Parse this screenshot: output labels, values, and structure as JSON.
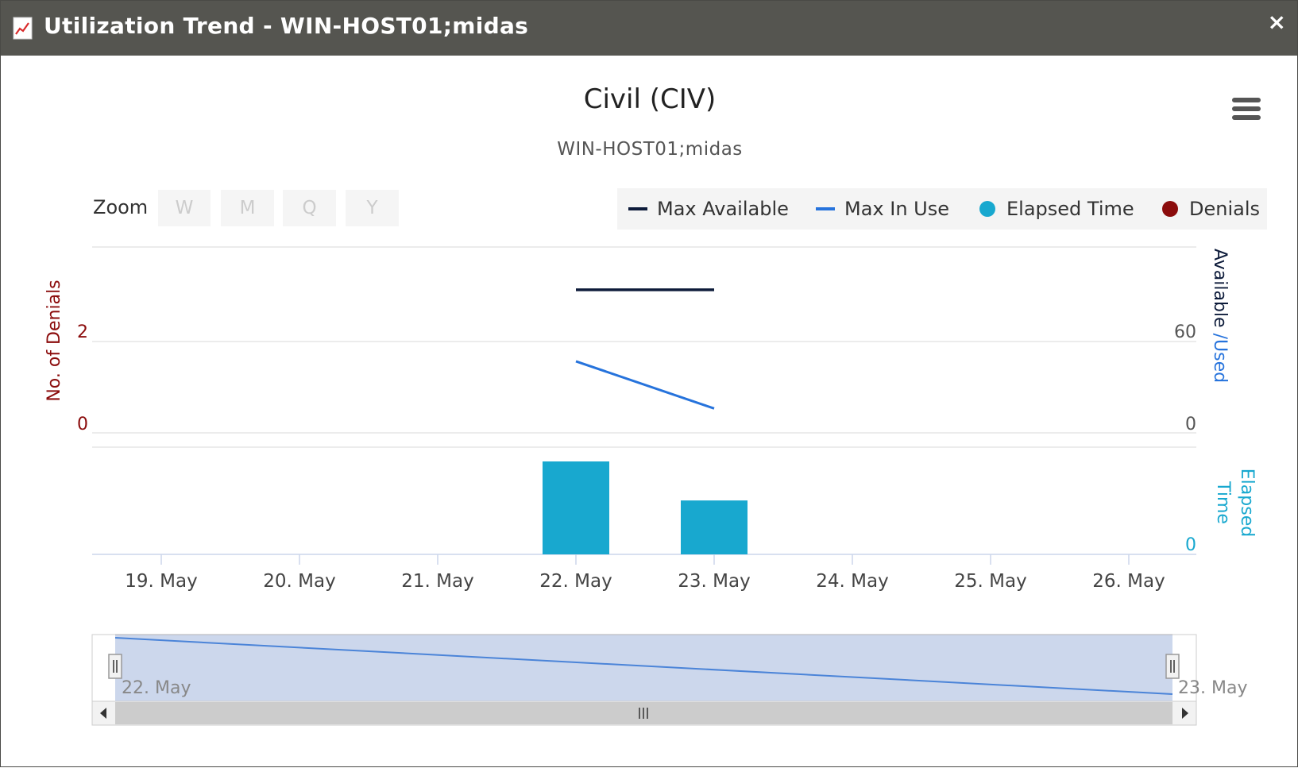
{
  "window": {
    "title": "Utilization Trend - WIN-HOST01;midas",
    "close_label": "×"
  },
  "chart": {
    "title": "Civil (CIV)",
    "subtitle": "WIN-HOST01;midas"
  },
  "zoom": {
    "label": "Zoom",
    "buttons": [
      "W",
      "M",
      "Q",
      "Y"
    ]
  },
  "legend": {
    "items": [
      {
        "label": "Max Available",
        "color": "#0d1b3a",
        "symbol": "line"
      },
      {
        "label": "Max In Use",
        "color": "#2673dc",
        "symbol": "line"
      },
      {
        "label": "Elapsed Time",
        "color": "#18a8cf",
        "symbol": "dot"
      },
      {
        "label": "Denials",
        "color": "#8b0c0c",
        "symbol": "dot"
      }
    ]
  },
  "colors": {
    "denials_axis": "#8b0c0c",
    "max_available": "#0d1b3a",
    "max_in_use": "#2673dc",
    "elapsed": "#18a8cf",
    "navigator_fill": "#ccd7ec",
    "navigator_line": "#4b84d8"
  },
  "chart_data": {
    "type": "line",
    "x_categories": [
      "19. May",
      "20. May",
      "21. May",
      "22. May",
      "23. May",
      "24. May",
      "25. May",
      "26. May"
    ],
    "x_range": [
      "18.5 May",
      "26.5 May"
    ],
    "left_axis": {
      "title": "No. of Denials",
      "ticks": [
        0,
        2
      ],
      "ylim": [
        0,
        2
      ]
    },
    "right_axis": {
      "title_part1": "Available",
      "title_sep": " /",
      "title_part2": "Used",
      "ticks": [
        0,
        60
      ],
      "ylim": [
        0,
        60
      ]
    },
    "elapsed_axis": {
      "title_line1": "Elapsed",
      "title_line2": "Time",
      "ticks": [
        0
      ]
    },
    "series": [
      {
        "name": "Max Available",
        "x": [
          "22. May",
          "23. May"
        ],
        "values": [
          94,
          94
        ]
      },
      {
        "name": "Max In Use",
        "x": [
          "22. May",
          "23. May"
        ],
        "values": [
          47,
          16
        ]
      },
      {
        "name": "Elapsed Time",
        "x": [
          "22. May",
          "23. May"
        ],
        "values": [
          1.0,
          0.58
        ]
      }
    ],
    "navigator": {
      "start_label": "22. May",
      "end_label": "23. May"
    },
    "grid": true,
    "legend_position": "top-right"
  }
}
